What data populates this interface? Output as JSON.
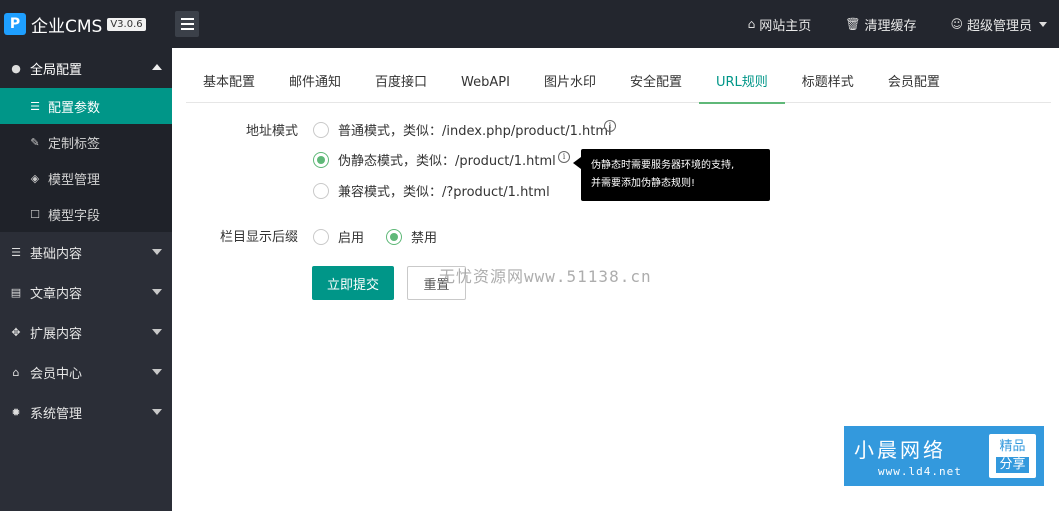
{
  "header": {
    "logo_mark": "P",
    "app_name": "企业CMS",
    "version": "V3.0.6",
    "links": [
      {
        "label": "网站主页",
        "icon": "home-icon"
      },
      {
        "label": "清理缓存",
        "icon": "trash-icon"
      },
      {
        "label": "超级管理员",
        "icon": "user-icon"
      }
    ]
  },
  "sidebar": {
    "groups": [
      {
        "label": "全局配置",
        "icon": "globe-icon",
        "open": true,
        "items": [
          {
            "label": "配置参数",
            "icon": "sliders-icon",
            "active": true
          },
          {
            "label": "定制标签",
            "icon": "wrench-icon"
          },
          {
            "label": "模型管理",
            "icon": "cube-icon"
          },
          {
            "label": "模型字段",
            "icon": "edit-icon"
          }
        ]
      },
      {
        "label": "基础内容",
        "icon": "sliders-icon"
      },
      {
        "label": "文章内容",
        "icon": "file-icon"
      },
      {
        "label": "扩展内容",
        "icon": "expand-icon"
      },
      {
        "label": "会员中心",
        "icon": "lock-icon"
      },
      {
        "label": "系统管理",
        "icon": "gear-icon"
      }
    ]
  },
  "tabs": [
    "基本配置",
    "邮件通知",
    "百度接口",
    "WebAPI",
    "图片水印",
    "安全配置",
    "URL规则",
    "标题样式",
    "会员配置"
  ],
  "active_tab": "URL规则",
  "form": {
    "url_mode": {
      "label": "地址模式",
      "options": [
        "普通模式，类似：/index.php/product/1.html",
        "伪静态模式，类似：/product/1.html",
        "兼容模式，类似：/?product/1.html"
      ],
      "selected": 1
    },
    "tooltip_lines": [
      "伪静态时需要服务器环境的支持,",
      "并需要添加伪静态规则!"
    ],
    "column_suffix": {
      "label": "栏目显示后缀",
      "options": [
        "启用",
        "禁用"
      ],
      "selected": 1
    },
    "submit_label": "立即提交",
    "reset_label": "重置"
  },
  "watermark": "无忧资源网www.51138.cn",
  "promo": {
    "title": "小晨网络",
    "url": "www.ld4.net",
    "badge_top": "精品",
    "badge_bottom": "分享"
  },
  "colors": {
    "accent": "#009688",
    "radio_on": "#5fb878",
    "header_bg": "#23262e",
    "sidebar_bg": "#2b2e37",
    "promo_bg": "#3399dd"
  }
}
